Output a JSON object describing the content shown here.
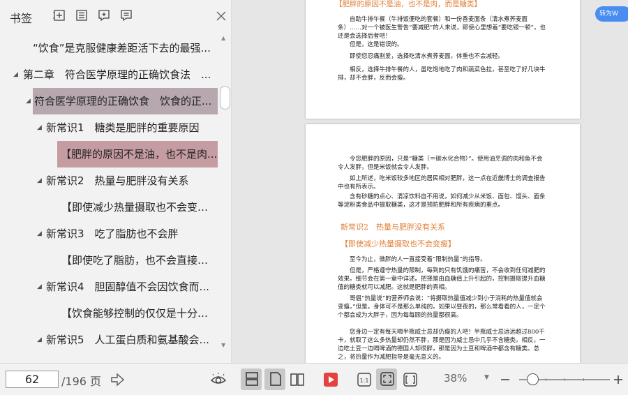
{
  "sidebar": {
    "title": "书签",
    "tools": [
      "expand-all-icon",
      "collapse-all-icon",
      "add-bookmark-icon",
      "bookmark-options-icon"
    ],
    "items": [
      {
        "label": "“饮食”是克服健康差距活下去的最强..."
      },
      {
        "label": "第二章　符合医学原理的正确饮食法　..."
      },
      {
        "label": "符合医学原理的正确饮食　饮食的正..."
      },
      {
        "label": "新常识1　糖类是肥胖的重要原因"
      },
      {
        "label": "【肥胖的原因不是油，也不是肉..."
      },
      {
        "label": "新常识2　热量与肥胖没有关系"
      },
      {
        "label": "【即使减少热量摄取也不会变瘦..."
      },
      {
        "label": "新常识3　吃了脂肪也不会胖"
      },
      {
        "label": "【即使吃了脂肪，也不会直接仔..."
      },
      {
        "label": "新常识4　胆固醇值不会因饮食而..."
      },
      {
        "label": "【饮食能够控制的仅仅是十分之..."
      },
      {
        "label": "新常识5　人工蛋白质和氨基酸会..."
      }
    ]
  },
  "document": {
    "convert_label": "转为W",
    "page1": {
      "heading": "【肥胖的原因不是油，也不是肉，而是糖类】",
      "p1": "自助牛排午餐（牛排饭便吃的套餐）和一份香麦面条（清水煮荞麦面条）……对一个被医生警告“要减肥”的人来说，即使心里想着“要吃银一顿”，也还是会选择后者吧！",
      "p2": "但是，这是错误的。",
      "p3": "即使您忍痛割爱，选择吃清水煮荞麦面，体重也不会减轻。",
      "p4": "相反，选择牛排午餐的人，虽吃饱地吃了肉和蔬菜色拉，甚至吃了好几块牛排，却不会胖，反而会瘦。"
    },
    "page2": {
      "p1": "令您肥胖的原因，只是“糖类（＝碳水化合物）”。使用油烹调的肉和鱼不会令人发胖，但是米饭就会令人发胖。",
      "p2": "如上所述，吃米饭较多地区的居民相对肥胖，这一点在近畿博士的调查报告中也有所表示。",
      "p3": "含有砂糖的点心、清凉饮料自不用说，如何减少从米饭、面包、馒头、面条等淀粉类食品中摄取糖类，这才是预防肥胖和所有疾病的重点。",
      "heading1": "新常识2　热量与肥胖没有关系",
      "heading2": "【即使减少热量摄取也不会变瘦】",
      "p4": "至今为止，微胖的人一直接受着“限制热量”的指导。",
      "p5": "但是，严格遵守热量的限制，每到的只有饥饿的痛苦，不会收到任何减肥的效果。细节会在第一章中详述。把择是由血糖值上升引起的，控制摄取提升血糖值的糖类就可以减肥。这就是肥胖的真相。",
      "p6": "哥倡“热量说”的营养师会说：“将摄取热量值减少到小于消耗的热量值就会变瘦。”但是，身体可不是那么单纯的。如果以昼夜的，那么常看看的人，一定个个都会成为大胖子，因为每每顾的热量都很高。",
      "p7": "您身边一定有每天喝半瓶威士忌却仍瘦的人吧！半瓶威士忌远远超过800千卡，就取了这么多热量却仍然不胖，那是因为威士忌中几乎不含糖类。相反，一边吃土豆一边喝啤酒的德国人却很胖，那是因为土豆和啤酒中都含有糖类。总之，将热量作为减肥指导是毫无意义的。"
    }
  },
  "toolbar": {
    "page_number": "62",
    "page_total": "/196 页",
    "zoom": "38%",
    "zoom_level": 0.15,
    "icons": [
      "go-to-page-icon",
      "reading-mode-icon",
      "continuous-scroll-icon",
      "single-page-icon",
      "two-page-icon",
      "play-icon",
      "actual-size-icon",
      "fit-page-icon",
      "fit-width-icon",
      "zoom-out-icon",
      "zoom-in-icon"
    ]
  }
}
